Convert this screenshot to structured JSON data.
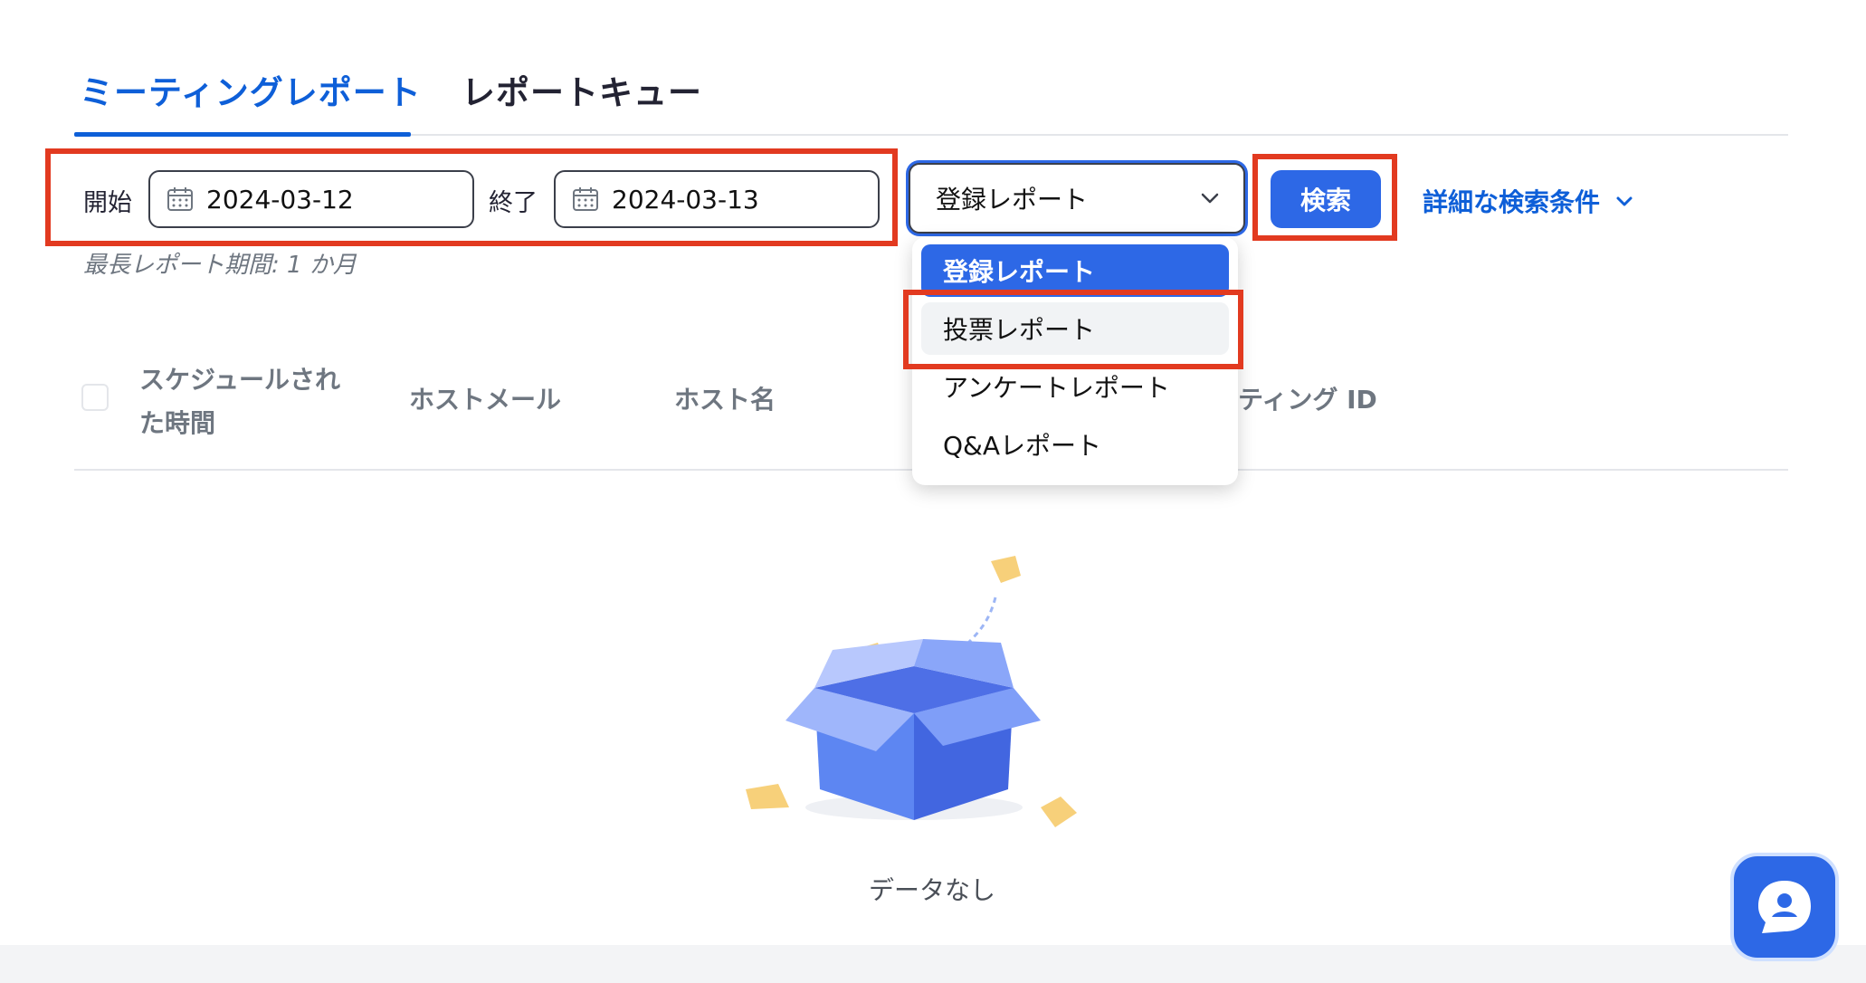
{
  "tabs": [
    {
      "label": "ミーティングレポート",
      "active": true
    },
    {
      "label": "レポートキュー",
      "active": false
    }
  ],
  "filters": {
    "start_label": "開始",
    "start_value": "2024-03-12",
    "end_label": "終了",
    "end_value": "2024-03-13",
    "report_type_selected": "登録レポート",
    "search_button": "検索",
    "advanced_link": "詳細な検索条件",
    "max_period_hint": "最長レポート期間: 1 か月"
  },
  "dropdown": {
    "options": [
      "登録レポート",
      "投票レポート",
      "アンケートレポート",
      "Q&Aレポート"
    ]
  },
  "table": {
    "headers": {
      "scheduled_time_line1": "スケジュールされ",
      "scheduled_time_line2": "た時間",
      "host_email": "ホストメール",
      "host_name": "ホスト名",
      "meeting_id_partial": "ーティング ID"
    },
    "empty_text": "データなし"
  },
  "colors": {
    "accent": "#2d68e6",
    "tab_active": "#0e5fd8",
    "highlight": "#e23a20"
  },
  "icons": {
    "calendar": "calendar-icon",
    "chevron": "chevron-down-icon",
    "chat": "chat-assistant-icon"
  }
}
